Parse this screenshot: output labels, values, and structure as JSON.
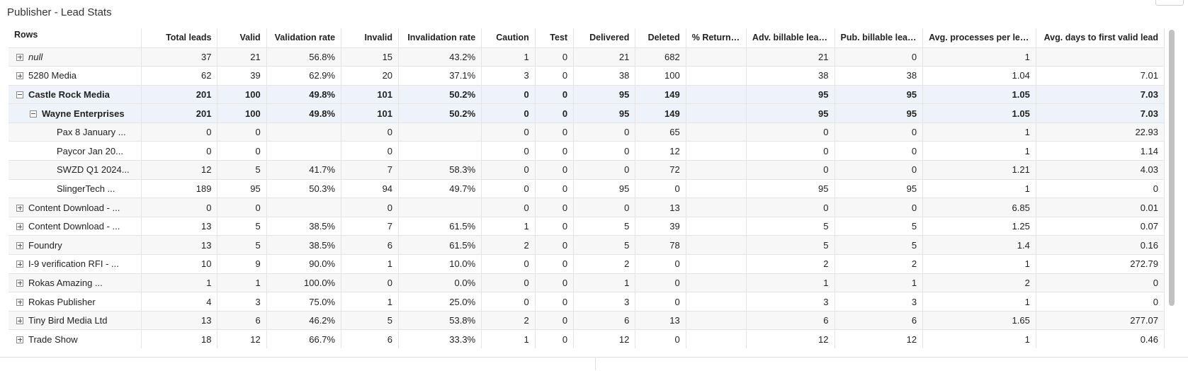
{
  "title": "Publisher - Lead Stats",
  "columns": [
    "Rows",
    "Total leads",
    "Valid",
    "Validation rate",
    "Invalid",
    "Invalidation rate",
    "Caution",
    "Test",
    "Delivered",
    "Deleted",
    "% Returned",
    "Adv. billable leads",
    "Pub. billable leads",
    "Avg. processes per lead",
    "Avg. days to first valid lead"
  ],
  "rows": [
    {
      "label": "null",
      "toggle": "plus",
      "indent": 0,
      "italic": true,
      "values": [
        "37",
        "21",
        "56.8%",
        "15",
        "43.2%",
        "1",
        "0",
        "21",
        "682",
        "",
        "21",
        "0",
        "1",
        ""
      ]
    },
    {
      "label": "5280 Media",
      "toggle": "plus",
      "indent": 0,
      "values": [
        "62",
        "39",
        "62.9%",
        "20",
        "37.1%",
        "3",
        "0",
        "38",
        "100",
        "",
        "38",
        "38",
        "1.04",
        "7.01"
      ]
    },
    {
      "label": "Castle Rock Media",
      "toggle": "minus",
      "indent": 0,
      "highlight": true,
      "values": [
        "201",
        "100",
        "49.8%",
        "101",
        "50.2%",
        "0",
        "0",
        "95",
        "149",
        "",
        "95",
        "95",
        "1.05",
        "7.03"
      ]
    },
    {
      "label": "Wayne Enterprises",
      "toggle": "minus",
      "indent": 1,
      "highlight": true,
      "values": [
        "201",
        "100",
        "49.8%",
        "101",
        "50.2%",
        "0",
        "0",
        "95",
        "149",
        "",
        "95",
        "95",
        "1.05",
        "7.03"
      ]
    },
    {
      "label": "Pax 8 January ...",
      "toggle": "",
      "indent": 2,
      "values": [
        "0",
        "0",
        "",
        "0",
        "",
        "0",
        "0",
        "0",
        "65",
        "",
        "0",
        "0",
        "1",
        "22.93"
      ]
    },
    {
      "label": "Paycor Jan 20...",
      "toggle": "",
      "indent": 2,
      "values": [
        "0",
        "0",
        "",
        "0",
        "",
        "0",
        "0",
        "0",
        "12",
        "",
        "0",
        "0",
        "1",
        "1.14"
      ]
    },
    {
      "label": "SWZD Q1 2024...",
      "toggle": "",
      "indent": 2,
      "values": [
        "12",
        "5",
        "41.7%",
        "7",
        "58.3%",
        "0",
        "0",
        "0",
        "72",
        "",
        "0",
        "0",
        "1.21",
        "4.03"
      ]
    },
    {
      "label": "SlingerTech ...",
      "toggle": "",
      "indent": 2,
      "values": [
        "189",
        "95",
        "50.3%",
        "94",
        "49.7%",
        "0",
        "0",
        "95",
        "0",
        "",
        "95",
        "95",
        "1",
        "0"
      ]
    },
    {
      "label": "Content Download - ...",
      "toggle": "plus",
      "indent": 0,
      "values": [
        "0",
        "0",
        "",
        "0",
        "",
        "0",
        "0",
        "0",
        "13",
        "",
        "0",
        "0",
        "6.85",
        "0.01"
      ]
    },
    {
      "label": "Content Download - ...",
      "toggle": "plus",
      "indent": 0,
      "values": [
        "13",
        "5",
        "38.5%",
        "7",
        "61.5%",
        "1",
        "0",
        "5",
        "39",
        "",
        "5",
        "5",
        "1.25",
        "0.07"
      ]
    },
    {
      "label": "Foundry",
      "toggle": "plus",
      "indent": 0,
      "values": [
        "13",
        "5",
        "38.5%",
        "6",
        "61.5%",
        "2",
        "0",
        "5",
        "78",
        "",
        "5",
        "5",
        "1.4",
        "0.16"
      ]
    },
    {
      "label": "I-9 verification RFI - ...",
      "toggle": "plus",
      "indent": 0,
      "values": [
        "10",
        "9",
        "90.0%",
        "1",
        "10.0%",
        "0",
        "0",
        "2",
        "0",
        "",
        "2",
        "2",
        "1",
        "272.79"
      ]
    },
    {
      "label": "Rokas Amazing ...",
      "toggle": "plus",
      "indent": 0,
      "values": [
        "1",
        "1",
        "100.0%",
        "0",
        "0.0%",
        "0",
        "0",
        "1",
        "0",
        "",
        "1",
        "1",
        "2",
        "0"
      ]
    },
    {
      "label": "Rokas Publisher",
      "toggle": "plus",
      "indent": 0,
      "values": [
        "4",
        "3",
        "75.0%",
        "1",
        "25.0%",
        "0",
        "0",
        "3",
        "0",
        "",
        "3",
        "3",
        "1",
        "0"
      ]
    },
    {
      "label": "Tiny Bird Media Ltd",
      "toggle": "plus",
      "indent": 0,
      "values": [
        "13",
        "6",
        "46.2%",
        "5",
        "53.8%",
        "2",
        "0",
        "6",
        "13",
        "",
        "6",
        "6",
        "1.65",
        "277.07"
      ]
    },
    {
      "label": "Trade Show",
      "toggle": "plus",
      "indent": 0,
      "values": [
        "18",
        "12",
        "66.7%",
        "6",
        "33.3%",
        "1",
        "0",
        "12",
        "0",
        "",
        "12",
        "12",
        "1",
        "0.46"
      ]
    }
  ]
}
